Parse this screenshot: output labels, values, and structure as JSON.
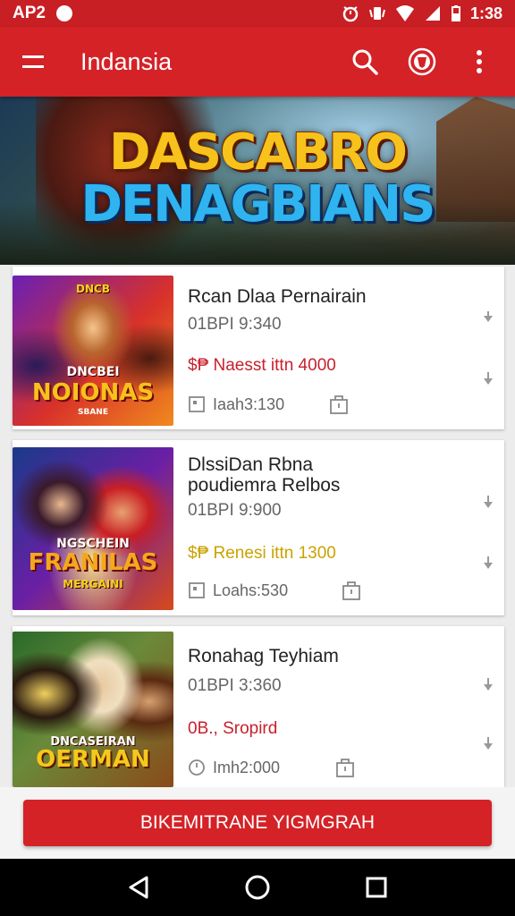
{
  "status": {
    "left_text": "AP2",
    "time": "1:38"
  },
  "app_bar": {
    "title": "Indansia"
  },
  "banner": {
    "line1": "DASCABRO",
    "line2": "DENAGBIANS"
  },
  "items": [
    {
      "title": "Rcan Dlaa Pernairain",
      "code": "01BPI 9:340",
      "price": "$₱ Naesst ittn 4000",
      "price_color": "#c8202c",
      "foot": "Iaah3:130",
      "thumb_top": "DNCB",
      "thumb_main": "NOIONAS",
      "thumb_sub": "DNCBEI",
      "thumb_bottom": "SBANE"
    },
    {
      "title": "DlssiDan Rbna poudiemra Relbos",
      "code": "01BPI 9:900",
      "price": "$₱ Renesi ittn 1300",
      "price_color": "#c9a200",
      "foot": "Loahs:530",
      "thumb_top": "NGSCHEIN",
      "thumb_main": "FRANILAS",
      "thumb_sub": "MERGAINI",
      "thumb_bottom": ""
    },
    {
      "title": "Ronahag Teyhiam",
      "code": "01BPI 3:360",
      "price": "0B., Sropird",
      "price_color": "#c8202c",
      "foot": "Imh2:000",
      "thumb_top": "",
      "thumb_main": "OERMAN",
      "thumb_sub": "DNCASEIRAN",
      "thumb_bottom": ""
    }
  ],
  "primary_button": {
    "label": "BIKEMITRANE YIGMGRAH"
  },
  "icons": {
    "menu": "hamburger-icon",
    "search": "search-icon",
    "profile": "shield-icon",
    "more": "more-vert-icon",
    "calendar": "calendar-icon",
    "save": "bag-icon",
    "back": "back-triangle-icon",
    "home": "home-circle-icon",
    "recents": "recents-square-icon"
  },
  "colors": {
    "primary": "#d42227",
    "status_bar": "#c81f24"
  }
}
